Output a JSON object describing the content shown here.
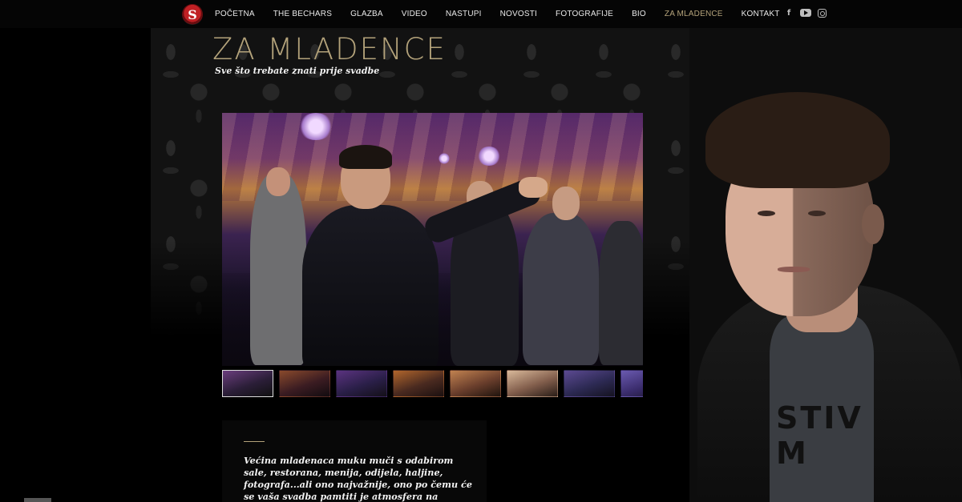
{
  "nav": {
    "logo_letter": "S",
    "items": [
      {
        "label": "POČETNA",
        "active": false
      },
      {
        "label": "THE BECHARS",
        "active": false
      },
      {
        "label": "GLAZBA",
        "active": false
      },
      {
        "label": "VIDEO",
        "active": false
      },
      {
        "label": "NASTUPI",
        "active": false
      },
      {
        "label": "NOVOSTI",
        "active": false
      },
      {
        "label": "FOTOGRAFIJE",
        "active": false
      },
      {
        "label": "BIO",
        "active": false
      },
      {
        "label": "ZA MLADENCE",
        "active": true
      },
      {
        "label": "KONTAKT",
        "active": false
      }
    ],
    "social": [
      "facebook-icon",
      "youtube-icon",
      "instagram-icon"
    ],
    "facebook_glyph": "f"
  },
  "page": {
    "title": "ZA MLADENCE",
    "subtitle": "Sve što trebate znati prije svadbe"
  },
  "gallery": {
    "thumbnail_count": 8,
    "selected_index": 0
  },
  "content": {
    "lead": "Većina mladenaca muku muči s odabirom sale, restorana, menija, odijela, haljine, fotografa...ali ono najvažnije, ono po čemu će se vaša svadba pamtiti je atmosfera na plesnom podiju i oko"
  },
  "model": {
    "shirt_text": "STIV\nM"
  },
  "colors": {
    "accent": "#b3a27a",
    "background": "#000000",
    "nav_text": "#e8e8e8"
  }
}
